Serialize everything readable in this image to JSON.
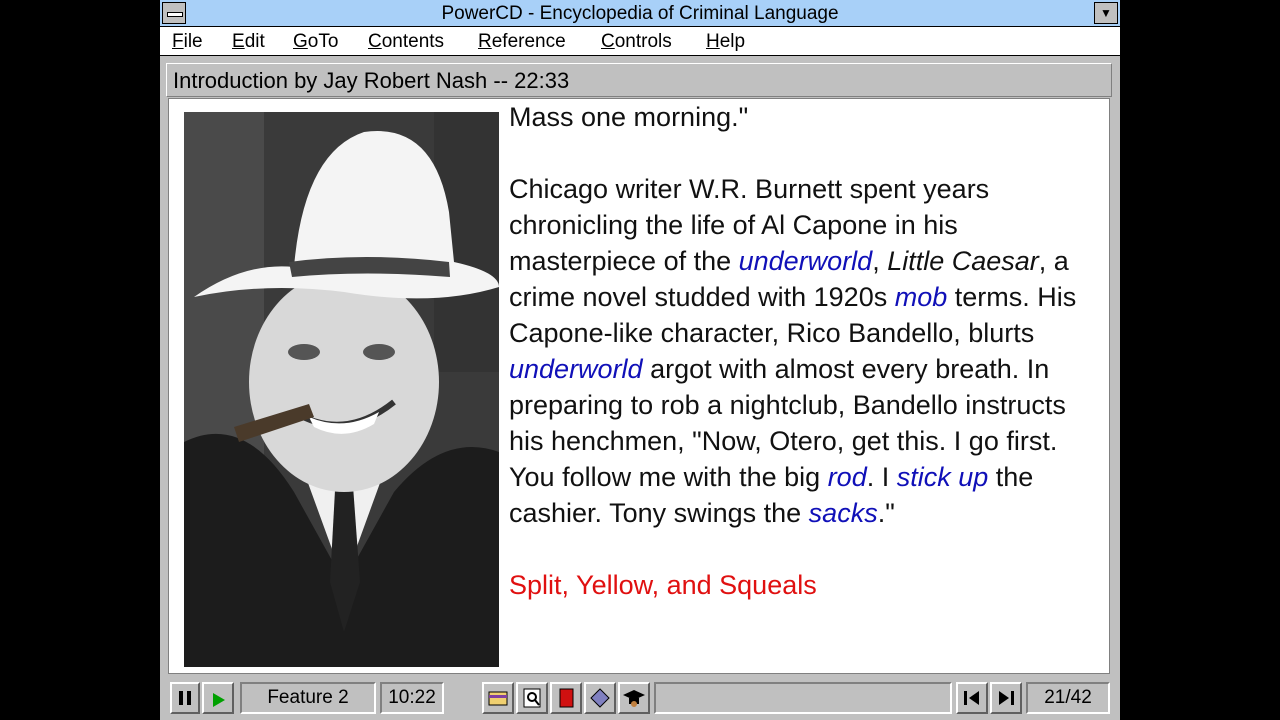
{
  "window": {
    "title": "PowerCD - Encyclopedia of Criminal Language"
  },
  "menu": [
    "File",
    "Edit",
    "GoTo",
    "Contents",
    "Reference",
    "Controls",
    "Help"
  ],
  "section": {
    "header": "Introduction by Jay Robert Nash -- 22:33"
  },
  "article": {
    "line0": "Mass one morning.\"",
    "p1_a": "Chicago writer W.R. Burnett spent years chronicling the life of Al Capone in his masterpiece of the ",
    "p1_link_underworld_1": "underworld",
    "p1_b": ", ",
    "p1_title": "Little Caesar",
    "p1_c": ", a crime novel studded with 1920s ",
    "p1_link_mob": "mob",
    "p1_d": " terms.  His Capone-like character, Rico Bandello, blurts ",
    "p1_link_underworld_2": "underworld",
    "p1_e": " argot with almost every breath.  In preparing to rob a nightclub, Bandello instructs his henchmen, \"Now, Otero, get this.  I go first.  You follow me with the big ",
    "p1_link_rod": "rod",
    "p1_f": ".  I ",
    "p1_link_stickup": "stick up",
    "p1_g": " the cashier.  Tony swings the ",
    "p1_link_sacks": "sacks",
    "p1_h": ".\"",
    "subheading": "Split, Yellow, and Squeals"
  },
  "statusbar": {
    "feature": "Feature 2",
    "time": "10:22",
    "page": "21/42"
  },
  "colors": {
    "titlebar": "#a8d0f8",
    "link": "#1010b8",
    "subheading": "#e01010",
    "play": "#00a000"
  },
  "icons": [
    "pause-icon",
    "play-icon",
    "notebook-icon",
    "search-document-icon",
    "red-book-icon",
    "diamond-icon",
    "graduate-cap-icon",
    "previous-icon",
    "next-icon"
  ]
}
